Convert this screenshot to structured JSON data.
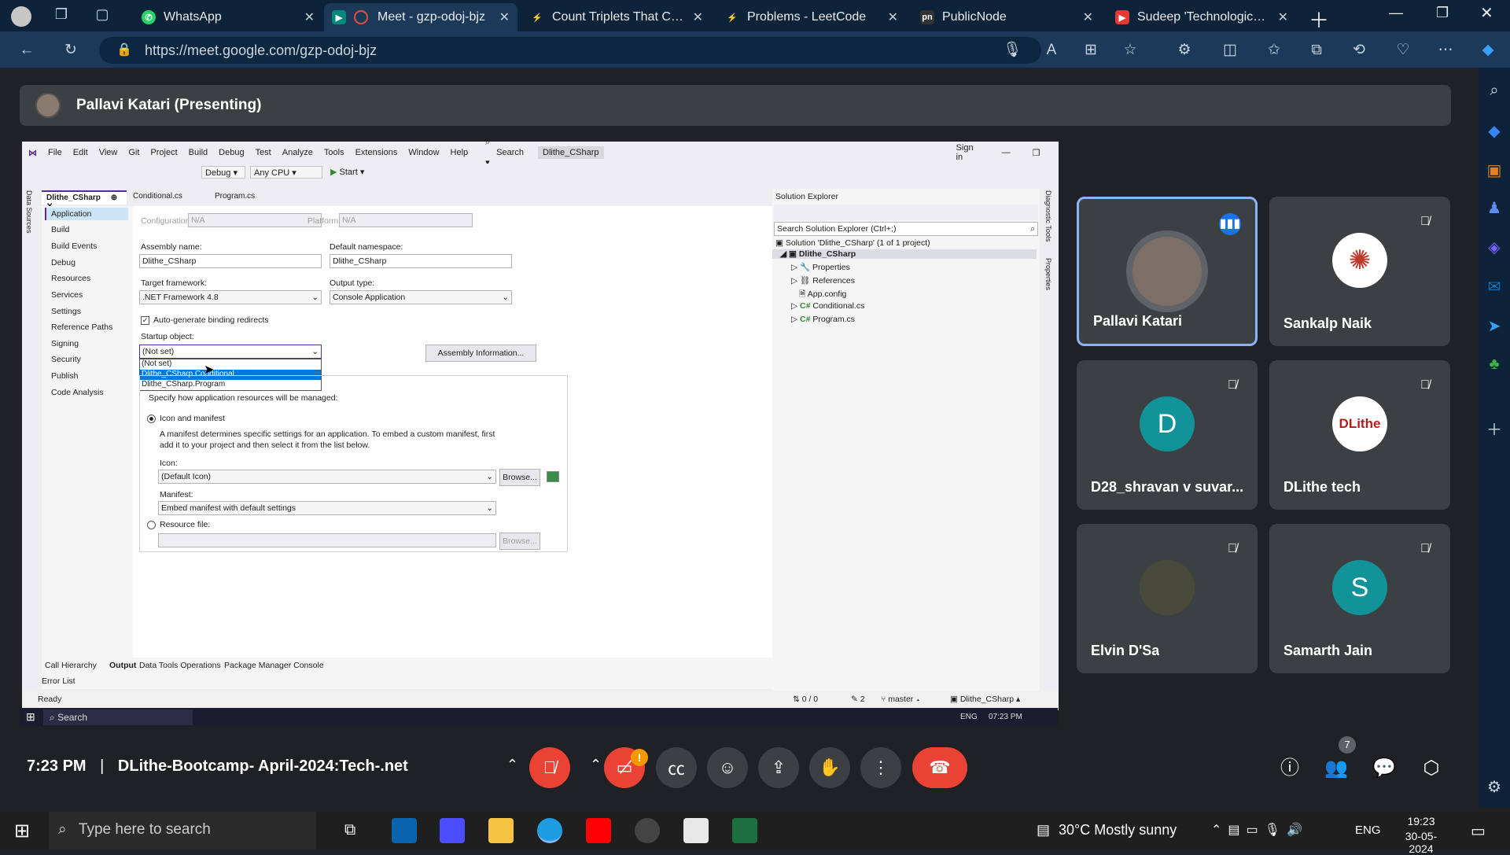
{
  "browser": {
    "tabs": [
      {
        "title": "WhatsApp",
        "icon": "whatsapp-icon",
        "color": "#25d366"
      },
      {
        "title": "Meet - gzp-odoj-bjz",
        "icon": "meet-icon",
        "color": "#00897b"
      },
      {
        "title": "Count Triplets That Can F",
        "icon": "leetcode-icon",
        "color": "#f89f1b"
      },
      {
        "title": "Problems - LeetCode",
        "icon": "leetcode-icon",
        "color": "#f89f1b"
      },
      {
        "title": "PublicNode",
        "icon": "publicnode-icon",
        "color": "#333333"
      },
      {
        "title": "Sudeep 'Technological A",
        "icon": "youtube-icon",
        "color": "#e53935"
      }
    ],
    "url": "https://meet.google.com/gzp-odoj-bjz"
  },
  "meet": {
    "presenter_label": "Pallavi Katari (Presenting)",
    "time": "7:23 PM",
    "meeting_title": "DLithe-Bootcamp- April-2024:Tech-.net",
    "participant_count": "7",
    "participants": [
      {
        "name": "Pallavi Katari",
        "initial": "",
        "color": "#7b6f67",
        "speaking": true,
        "muted": false
      },
      {
        "name": "Sankalp Naik",
        "initial": "",
        "color": "#ffffff",
        "speaking": false,
        "muted": true
      },
      {
        "name": "D28_shravan v suvar...",
        "initial": "D",
        "color": "#12939a",
        "speaking": false,
        "muted": true
      },
      {
        "name": "DLithe tech",
        "initial": "DLithe",
        "color": "#b71c1c",
        "speaking": false,
        "muted": true
      },
      {
        "name": "Elvin D'Sa",
        "initial": "",
        "color": "#4a4a3a",
        "speaking": false,
        "muted": true
      },
      {
        "name": "Samarth Jain",
        "initial": "S",
        "color": "#12939a",
        "speaking": false,
        "muted": true
      }
    ],
    "alert_badge": "!"
  },
  "vs": {
    "menu": [
      "File",
      "Edit",
      "View",
      "Git",
      "Project",
      "Build",
      "Debug",
      "Test",
      "Analyze",
      "Tools",
      "Extensions",
      "Window",
      "Help"
    ],
    "search_label": "Search",
    "solution_name_badge": "Dlithe_CSharp",
    "sign_in": "Sign in",
    "toolbar": {
      "config": "Debug",
      "platform": "Any CPU",
      "start": "Start"
    },
    "doc_tabs": [
      "Dlithe_CSharp",
      "Conditional.cs",
      "Program.cs"
    ],
    "nav": [
      "Application",
      "Build",
      "Build Events",
      "Debug",
      "Resources",
      "Services",
      "Settings",
      "Reference Paths",
      "Signing",
      "Security",
      "Publish",
      "Code Analysis"
    ],
    "configuration_label": "Configuration:",
    "configuration_value": "N/A",
    "platform_label": "Platform:",
    "platform_value": "N/A",
    "assembly_name_label": "Assembly name:",
    "assembly_name": "Dlithe_CSharp",
    "default_namespace_label": "Default namespace:",
    "default_namespace": "Dlithe_CSharp",
    "target_framework_label": "Target framework:",
    "target_framework": ".NET Framework 4.8",
    "output_type_label": "Output type:",
    "output_type": "Console Application",
    "auto_binding": "Auto-generate binding redirects",
    "startup_label": "Startup object:",
    "startup_value": "(Not set)",
    "startup_options": [
      "(Not set)",
      "Dlithe_CSharp.Conditional",
      "Dlithe_CSharp.Program"
    ],
    "assembly_info_btn": "Assembly Information...",
    "resources_hint": "Specify how application resources will be managed:",
    "icon_manifest": "Icon and manifest",
    "manifest_desc1": "A manifest determines specific settings for an application. To embed a custom manifest, first",
    "manifest_desc2": "add it to your project and then select it from the list below.",
    "icon_label": "Icon:",
    "icon_value": "(Default Icon)",
    "browse": "Browse...",
    "manifest_label": "Manifest:",
    "manifest_value": "Embed manifest with default settings",
    "resource_file": "Resource file:",
    "solution_explorer_title": "Solution Explorer",
    "solution_search": "Search Solution Explorer (Ctrl+;)",
    "solution_tree": [
      "Solution 'Dlithe_CSharp' (1 of 1 project)",
      "Dlithe_CSharp",
      "Properties",
      "References",
      "App.config",
      "Conditional.cs",
      "Program.cs"
    ],
    "bottom_tabs": [
      "Call Hierarchy",
      "Output",
      "Data Tools Operations",
      "Package Manager Console"
    ],
    "error_list": "Error List",
    "status_ready": "Ready",
    "status_lines": "0 / 0",
    "status_edits": "2",
    "status_branch": "master",
    "status_repo": "Dlithe_CSharp",
    "inner_taskbar_search": "Search",
    "inner_lang": "ENG",
    "inner_time": "07:23 PM",
    "side_tabs": [
      "Data Sources",
      "Diagnostic Tools",
      "Properties"
    ]
  },
  "taskbar": {
    "search_placeholder": "Type here to search",
    "weather": "30°C  Mostly sunny",
    "lang": "ENG",
    "time": "19:23",
    "date": "30-05-2024"
  }
}
